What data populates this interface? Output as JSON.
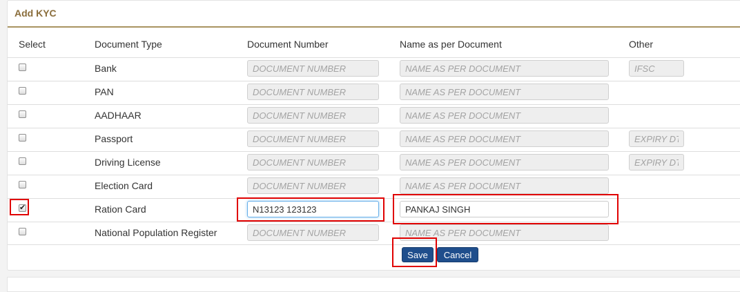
{
  "panel": {
    "title": "Add KYC"
  },
  "table": {
    "headers": {
      "select": "Select",
      "document_type": "Document Type",
      "document_number": "Document Number",
      "name_as_per_document": "Name as per Document",
      "other": "Other"
    },
    "rows": [
      {
        "label": "Bank",
        "checked": false,
        "doc_number_placeholder": "DOCUMENT NUMBER",
        "doc_number_value": "",
        "name_placeholder": "NAME AS PER DOCUMENT",
        "name_value": "",
        "other_placeholder": "IFSC"
      },
      {
        "label": "PAN",
        "checked": false,
        "doc_number_placeholder": "DOCUMENT NUMBER",
        "doc_number_value": "",
        "name_placeholder": "NAME AS PER DOCUMENT",
        "name_value": "",
        "other_placeholder": ""
      },
      {
        "label": "AADHAAR",
        "checked": false,
        "doc_number_placeholder": "DOCUMENT NUMBER",
        "doc_number_value": "",
        "name_placeholder": "NAME AS PER DOCUMENT",
        "name_value": "",
        "other_placeholder": ""
      },
      {
        "label": "Passport",
        "checked": false,
        "doc_number_placeholder": "DOCUMENT NUMBER",
        "doc_number_value": "",
        "name_placeholder": "NAME AS PER DOCUMENT",
        "name_value": "",
        "other_placeholder": "EXPIRY DT"
      },
      {
        "label": "Driving License",
        "checked": false,
        "doc_number_placeholder": "DOCUMENT NUMBER",
        "doc_number_value": "",
        "name_placeholder": "NAME AS PER DOCUMENT",
        "name_value": "",
        "other_placeholder": "EXPIRY DT"
      },
      {
        "label": "Election Card",
        "checked": false,
        "doc_number_placeholder": "DOCUMENT NUMBER",
        "doc_number_value": "",
        "name_placeholder": "NAME AS PER DOCUMENT",
        "name_value": "",
        "other_placeholder": ""
      },
      {
        "label": "Ration Card",
        "checked": true,
        "doc_number_placeholder": "",
        "doc_number_value": "N13123 123123",
        "name_placeholder": "",
        "name_value": "PANKAJ SINGH",
        "other_placeholder": ""
      },
      {
        "label": "National Population Register",
        "checked": false,
        "doc_number_placeholder": "DOCUMENT NUMBER",
        "doc_number_value": "",
        "name_placeholder": "NAME AS PER DOCUMENT",
        "name_value": "",
        "other_placeholder": ""
      }
    ]
  },
  "actions": {
    "save_label": "Save",
    "cancel_label": "Cancel"
  },
  "colors": {
    "title": "#8a6d3b",
    "button": "#1f4e8c",
    "highlight": "#e00000"
  }
}
